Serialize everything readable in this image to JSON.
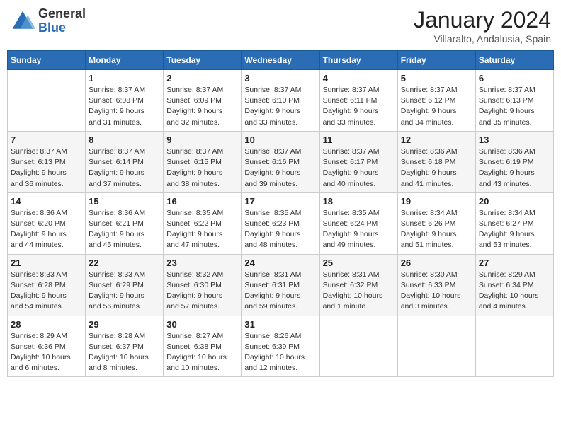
{
  "logo": {
    "general": "General",
    "blue": "Blue"
  },
  "header": {
    "month": "January 2024",
    "location": "Villaralto, Andalusia, Spain"
  },
  "days_of_week": [
    "Sunday",
    "Monday",
    "Tuesday",
    "Wednesday",
    "Thursday",
    "Friday",
    "Saturday"
  ],
  "weeks": [
    [
      {
        "day": "",
        "info": ""
      },
      {
        "day": "1",
        "info": "Sunrise: 8:37 AM\nSunset: 6:08 PM\nDaylight: 9 hours\nand 31 minutes."
      },
      {
        "day": "2",
        "info": "Sunrise: 8:37 AM\nSunset: 6:09 PM\nDaylight: 9 hours\nand 32 minutes."
      },
      {
        "day": "3",
        "info": "Sunrise: 8:37 AM\nSunset: 6:10 PM\nDaylight: 9 hours\nand 33 minutes."
      },
      {
        "day": "4",
        "info": "Sunrise: 8:37 AM\nSunset: 6:11 PM\nDaylight: 9 hours\nand 33 minutes."
      },
      {
        "day": "5",
        "info": "Sunrise: 8:37 AM\nSunset: 6:12 PM\nDaylight: 9 hours\nand 34 minutes."
      },
      {
        "day": "6",
        "info": "Sunrise: 8:37 AM\nSunset: 6:13 PM\nDaylight: 9 hours\nand 35 minutes."
      }
    ],
    [
      {
        "day": "7",
        "info": "Sunrise: 8:37 AM\nSunset: 6:13 PM\nDaylight: 9 hours\nand 36 minutes."
      },
      {
        "day": "8",
        "info": "Sunrise: 8:37 AM\nSunset: 6:14 PM\nDaylight: 9 hours\nand 37 minutes."
      },
      {
        "day": "9",
        "info": "Sunrise: 8:37 AM\nSunset: 6:15 PM\nDaylight: 9 hours\nand 38 minutes."
      },
      {
        "day": "10",
        "info": "Sunrise: 8:37 AM\nSunset: 6:16 PM\nDaylight: 9 hours\nand 39 minutes."
      },
      {
        "day": "11",
        "info": "Sunrise: 8:37 AM\nSunset: 6:17 PM\nDaylight: 9 hours\nand 40 minutes."
      },
      {
        "day": "12",
        "info": "Sunrise: 8:36 AM\nSunset: 6:18 PM\nDaylight: 9 hours\nand 41 minutes."
      },
      {
        "day": "13",
        "info": "Sunrise: 8:36 AM\nSunset: 6:19 PM\nDaylight: 9 hours\nand 43 minutes."
      }
    ],
    [
      {
        "day": "14",
        "info": "Sunrise: 8:36 AM\nSunset: 6:20 PM\nDaylight: 9 hours\nand 44 minutes."
      },
      {
        "day": "15",
        "info": "Sunrise: 8:36 AM\nSunset: 6:21 PM\nDaylight: 9 hours\nand 45 minutes."
      },
      {
        "day": "16",
        "info": "Sunrise: 8:35 AM\nSunset: 6:22 PM\nDaylight: 9 hours\nand 47 minutes."
      },
      {
        "day": "17",
        "info": "Sunrise: 8:35 AM\nSunset: 6:23 PM\nDaylight: 9 hours\nand 48 minutes."
      },
      {
        "day": "18",
        "info": "Sunrise: 8:35 AM\nSunset: 6:24 PM\nDaylight: 9 hours\nand 49 minutes."
      },
      {
        "day": "19",
        "info": "Sunrise: 8:34 AM\nSunset: 6:26 PM\nDaylight: 9 hours\nand 51 minutes."
      },
      {
        "day": "20",
        "info": "Sunrise: 8:34 AM\nSunset: 6:27 PM\nDaylight: 9 hours\nand 53 minutes."
      }
    ],
    [
      {
        "day": "21",
        "info": "Sunrise: 8:33 AM\nSunset: 6:28 PM\nDaylight: 9 hours\nand 54 minutes."
      },
      {
        "day": "22",
        "info": "Sunrise: 8:33 AM\nSunset: 6:29 PM\nDaylight: 9 hours\nand 56 minutes."
      },
      {
        "day": "23",
        "info": "Sunrise: 8:32 AM\nSunset: 6:30 PM\nDaylight: 9 hours\nand 57 minutes."
      },
      {
        "day": "24",
        "info": "Sunrise: 8:31 AM\nSunset: 6:31 PM\nDaylight: 9 hours\nand 59 minutes."
      },
      {
        "day": "25",
        "info": "Sunrise: 8:31 AM\nSunset: 6:32 PM\nDaylight: 10 hours\nand 1 minute."
      },
      {
        "day": "26",
        "info": "Sunrise: 8:30 AM\nSunset: 6:33 PM\nDaylight: 10 hours\nand 3 minutes."
      },
      {
        "day": "27",
        "info": "Sunrise: 8:29 AM\nSunset: 6:34 PM\nDaylight: 10 hours\nand 4 minutes."
      }
    ],
    [
      {
        "day": "28",
        "info": "Sunrise: 8:29 AM\nSunset: 6:36 PM\nDaylight: 10 hours\nand 6 minutes."
      },
      {
        "day": "29",
        "info": "Sunrise: 8:28 AM\nSunset: 6:37 PM\nDaylight: 10 hours\nand 8 minutes."
      },
      {
        "day": "30",
        "info": "Sunrise: 8:27 AM\nSunset: 6:38 PM\nDaylight: 10 hours\nand 10 minutes."
      },
      {
        "day": "31",
        "info": "Sunrise: 8:26 AM\nSunset: 6:39 PM\nDaylight: 10 hours\nand 12 minutes."
      },
      {
        "day": "",
        "info": ""
      },
      {
        "day": "",
        "info": ""
      },
      {
        "day": "",
        "info": ""
      }
    ]
  ]
}
